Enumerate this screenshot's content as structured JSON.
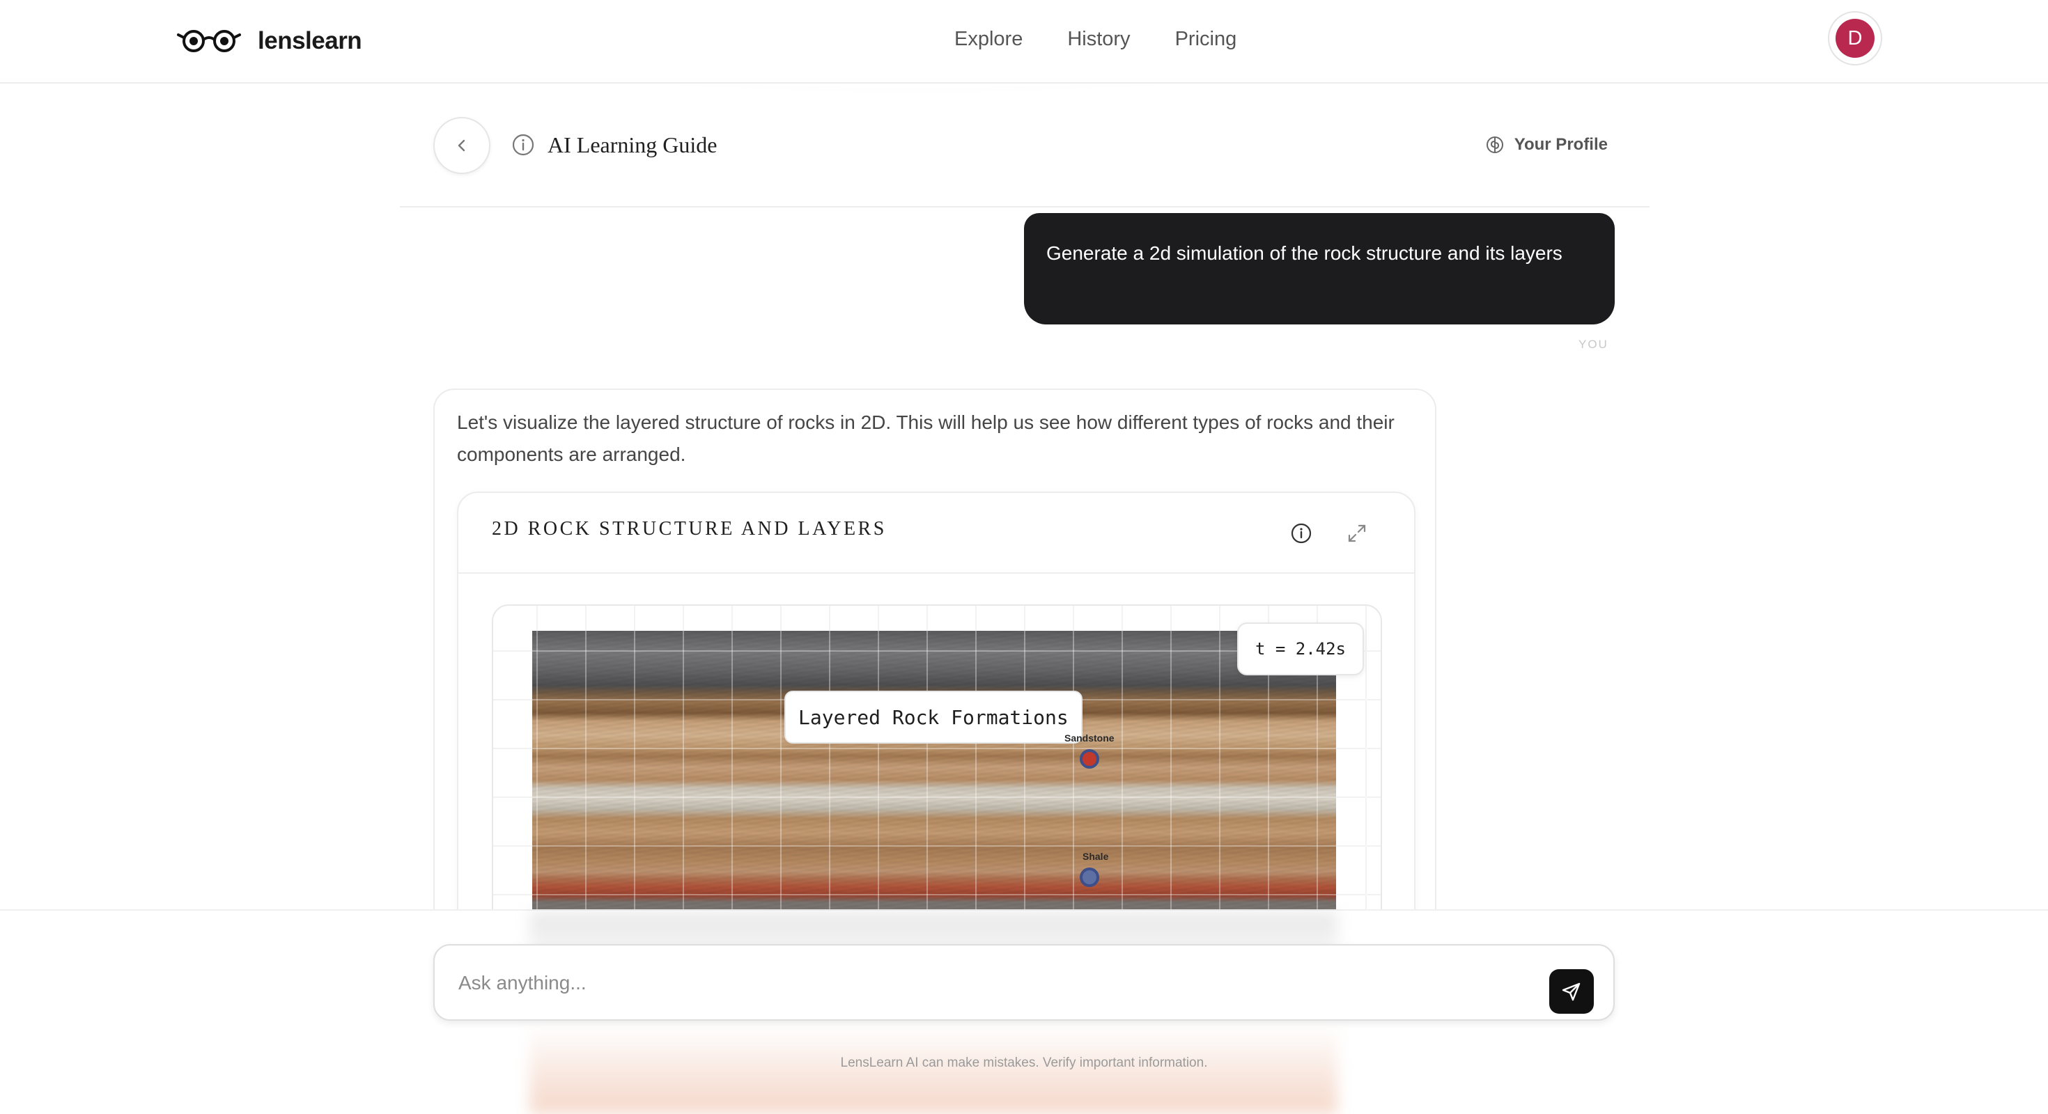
{
  "header": {
    "brand": "lenslearn",
    "nav": [
      {
        "label": "Explore"
      },
      {
        "label": "History"
      },
      {
        "label": "Pricing"
      }
    ],
    "avatar_initial": "D"
  },
  "subheader": {
    "title": "AI Learning Guide",
    "profile_label": "Your Profile"
  },
  "conversation": {
    "user_message": "Generate a 2d simulation of the rock structure and its layers",
    "user_tag": "YOU",
    "ai_message": "Let's visualize the layered structure of rocks in 2D. This will help us see how different types of rocks and their components are arranged."
  },
  "simulation": {
    "title": "2D ROCK STRUCTURE AND LAYERS",
    "time_readout": "t = 2.42s",
    "canvas_label": "Layered Rock Formations",
    "markers": [
      {
        "label": "Sandstone",
        "color": "#c0392b"
      },
      {
        "label": "Shale",
        "color": "#5d6fa3"
      }
    ]
  },
  "composer": {
    "placeholder": "Ask anything..."
  },
  "footer": {
    "disclaimer": "LensLearn AI can make mistakes. Verify important information."
  },
  "colors": {
    "accent_avatar": "#b8284f",
    "user_bubble": "#1c1c1e",
    "send_button": "#111111"
  }
}
